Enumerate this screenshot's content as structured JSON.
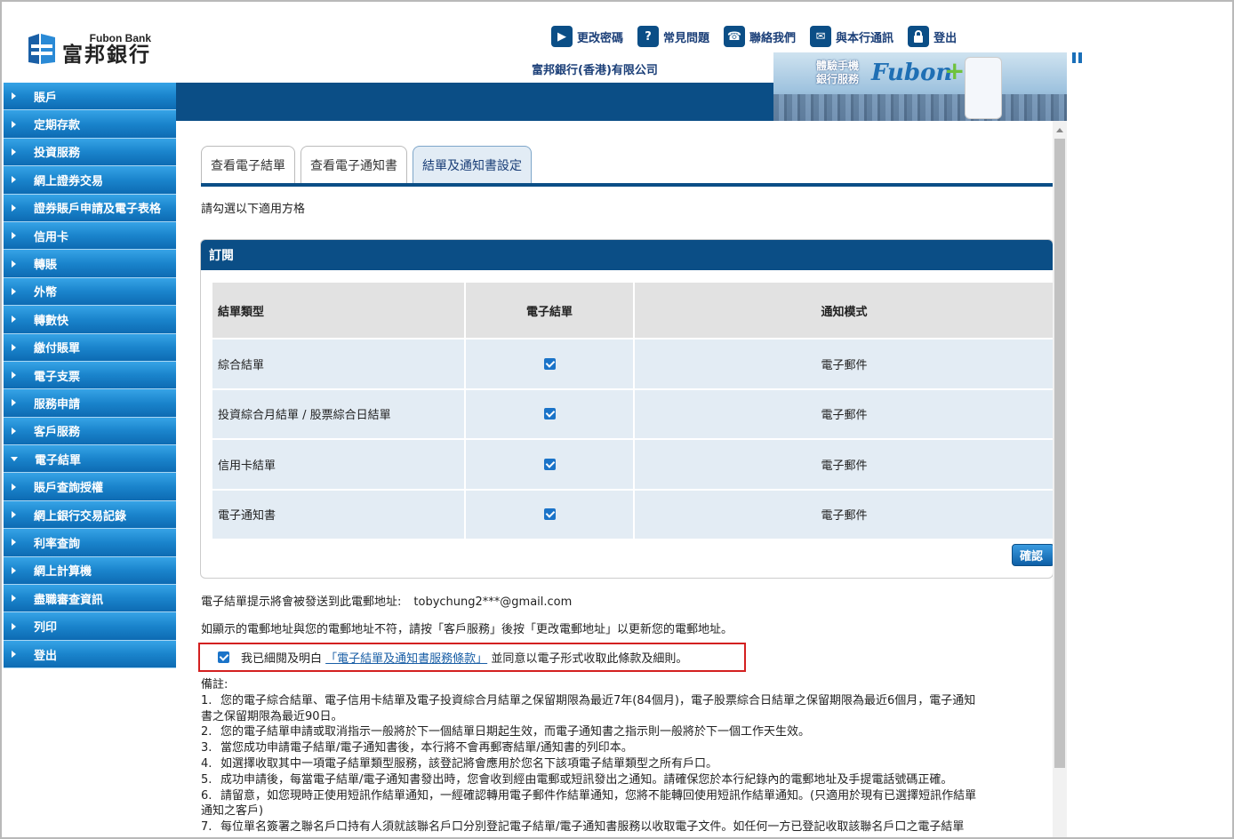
{
  "brand": {
    "name_en": "Fubon Bank",
    "name_zh": "富邦銀行",
    "company": "富邦銀行(香港)有限公司"
  },
  "topnav": [
    {
      "label": "更改密碼",
      "icon": "play-icon",
      "glyph": "▶"
    },
    {
      "label": "常見問題",
      "icon": "question-icon",
      "glyph": "?"
    },
    {
      "label": "聯絡我們",
      "icon": "phone-icon",
      "glyph": "☎"
    },
    {
      "label": "與本行通訊",
      "icon": "mail-icon",
      "glyph": "✉"
    },
    {
      "label": "登出",
      "icon": "lock-icon",
      "glyph": "🔒"
    }
  ],
  "banner": {
    "text_line1": "體驗手機",
    "text_line2": "銀行服務",
    "brand": "Fubon",
    "plus": "+"
  },
  "sidebar": {
    "items": [
      {
        "label": "賬戶",
        "expanded": false
      },
      {
        "label": "定期存款",
        "expanded": false
      },
      {
        "label": "投資服務",
        "expanded": false
      },
      {
        "label": "網上證券交易",
        "expanded": false
      },
      {
        "label": "證券賬戶申請及電子表格",
        "expanded": false
      },
      {
        "label": "信用卡",
        "expanded": false
      },
      {
        "label": "轉賬",
        "expanded": false
      },
      {
        "label": "外幣",
        "expanded": false
      },
      {
        "label": "轉數快",
        "expanded": false
      },
      {
        "label": "繳付賬單",
        "expanded": false
      },
      {
        "label": "電子支票",
        "expanded": false
      },
      {
        "label": "服務申請",
        "expanded": false
      },
      {
        "label": "客戶服務",
        "expanded": false
      },
      {
        "label": "電子結單",
        "expanded": true
      },
      {
        "label": "賬戶查詢授權",
        "expanded": false
      },
      {
        "label": "網上銀行交易記錄",
        "expanded": false
      },
      {
        "label": "利率查詢",
        "expanded": false
      },
      {
        "label": "網上計算機",
        "expanded": false
      },
      {
        "label": "盡職審查資訊",
        "expanded": false
      },
      {
        "label": "列印",
        "expanded": false
      },
      {
        "label": "登出",
        "expanded": false
      }
    ]
  },
  "tabs": [
    {
      "label": "查看電子結單",
      "active": false
    },
    {
      "label": "查看電子通知書",
      "active": false
    },
    {
      "label": "結單及通知書設定",
      "active": true
    }
  ],
  "instruction": "請勾選以下適用方格",
  "subscription": {
    "title": "訂閱",
    "headers": [
      "結單類型",
      "電子結單",
      "通知模式"
    ],
    "rows": [
      {
        "type": "綜合結單",
        "e_statement": true,
        "mode": "電子郵件"
      },
      {
        "type": "投資綜合月結單 / 股票綜合日結單",
        "e_statement": true,
        "mode": "電子郵件"
      },
      {
        "type": "信用卡結單",
        "e_statement": true,
        "mode": "電子郵件"
      },
      {
        "type": "電子通知書",
        "e_statement": true,
        "mode": "電子郵件"
      }
    ],
    "confirm_label": "確認"
  },
  "email": {
    "label": "電子結單提示將會被發送到此電郵地址:",
    "address": "tobychung2***@gmail.com",
    "note": "如顯示的電郵地址與您的電郵地址不符，請按「客戶服務」後按「更改電郵地址」以更新您的電郵地址。"
  },
  "agreement": {
    "checked": true,
    "prefix": "我已細閱及明白",
    "link": "「電子結單及通知書服務條款」",
    "suffix": "並同意以電子形式收取此條款及細則。"
  },
  "remarks": {
    "title": "備註:",
    "items": [
      {
        "no": "1.",
        "text": "您的電子綜合結單、電子信用卡結單及電子投資綜合月結單之保留期限為最近7年(84個月)，電子股票綜合日結單之保留期限為最近6個月，電子通知",
        "cont": "書之保留期限為最近90日。"
      },
      {
        "no": "2.",
        "text": "您的電子結單申請或取消指示一般將於下一個結單日期起生效，而電子通知書之指示則一般將於下一個工作天生效。",
        "cont": ""
      },
      {
        "no": "3.",
        "text": "當您成功申請電子結單/電子通知書後，本行將不會再郵寄結單/通知書的列印本。",
        "cont": ""
      },
      {
        "no": "4.",
        "text": "如選擇收取其中一項電子結單類型服務，該登記將會應用於您名下該項電子結單類型之所有戶口。",
        "cont": ""
      },
      {
        "no": "5.",
        "text": "成功申請後，每當電子結單/電子通知書發出時，您會收到經由電郵或短訊發出之通知。請確保您於本行紀錄內的電郵地址及手提電話號碼正確。",
        "cont": ""
      },
      {
        "no": "6.",
        "text": "請留意，如您現時正使用短訊作結單通知，一經確認轉用電子郵件作結單通知，您將不能轉回使用短訊作結單通知。(只適用於現有已選擇短訊作結單",
        "cont": "通知之客戶)"
      },
      {
        "no": "7.",
        "text": "每位單名簽署之聯名戶口持有人須就該聯名戶口分別登記電子結單/電子通知書服務以收取電子文件。如任何一方已登記收取該聯名戶口之電子結單",
        "cont": ""
      }
    ]
  },
  "colors": {
    "primary": "#0b4e86",
    "sidebar": "#1a84cc",
    "highlight_border": "#d32020",
    "row_bg": "#e3ecf4",
    "header_bg": "#e2e2e2"
  }
}
